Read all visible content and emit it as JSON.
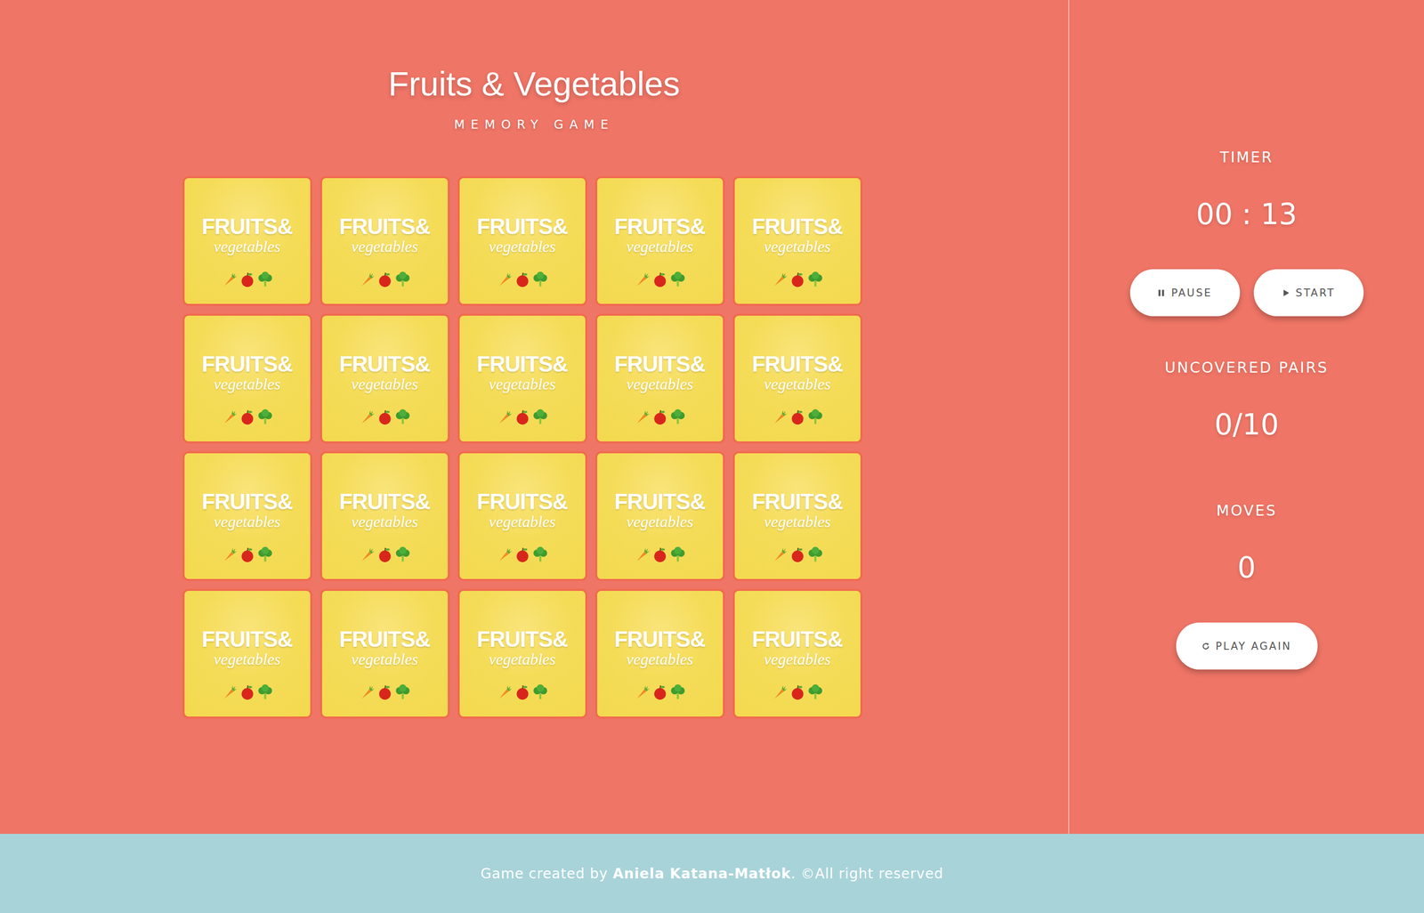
{
  "header": {
    "title": "Fruits & Vegetables",
    "subtitle": "MEMORY GAME"
  },
  "card_back": {
    "title": "FRUITS&",
    "subtitle": "vegetables"
  },
  "cards": [
    {
      "flipped": false
    },
    {
      "flipped": false
    },
    {
      "flipped": false
    },
    {
      "flipped": false
    },
    {
      "flipped": false
    },
    {
      "flipped": false
    },
    {
      "flipped": false
    },
    {
      "flipped": false
    },
    {
      "flipped": false
    },
    {
      "flipped": false
    },
    {
      "flipped": false
    },
    {
      "flipped": false
    },
    {
      "flipped": false
    },
    {
      "flipped": false
    },
    {
      "flipped": false
    },
    {
      "flipped": false
    },
    {
      "flipped": false
    },
    {
      "flipped": false
    },
    {
      "flipped": false
    },
    {
      "flipped": false
    }
  ],
  "sidebar": {
    "timer": {
      "label": "TIMER",
      "value": "00 : 13"
    },
    "buttons": [
      {
        "label": "PAUSE",
        "kind": "pause"
      },
      {
        "label": "START",
        "kind": "start"
      }
    ],
    "pairs": {
      "label": "UNCOVERED PAIRS",
      "value": "0/10"
    },
    "moves": {
      "label": "MOVES",
      "value": "0"
    },
    "play_again": {
      "label": "PLAY AGAIN"
    }
  },
  "footer": {
    "prefix": "Game created by ",
    "author": "Aniela Katana-Matłok",
    "suffix": ". ©All right reserved"
  }
}
